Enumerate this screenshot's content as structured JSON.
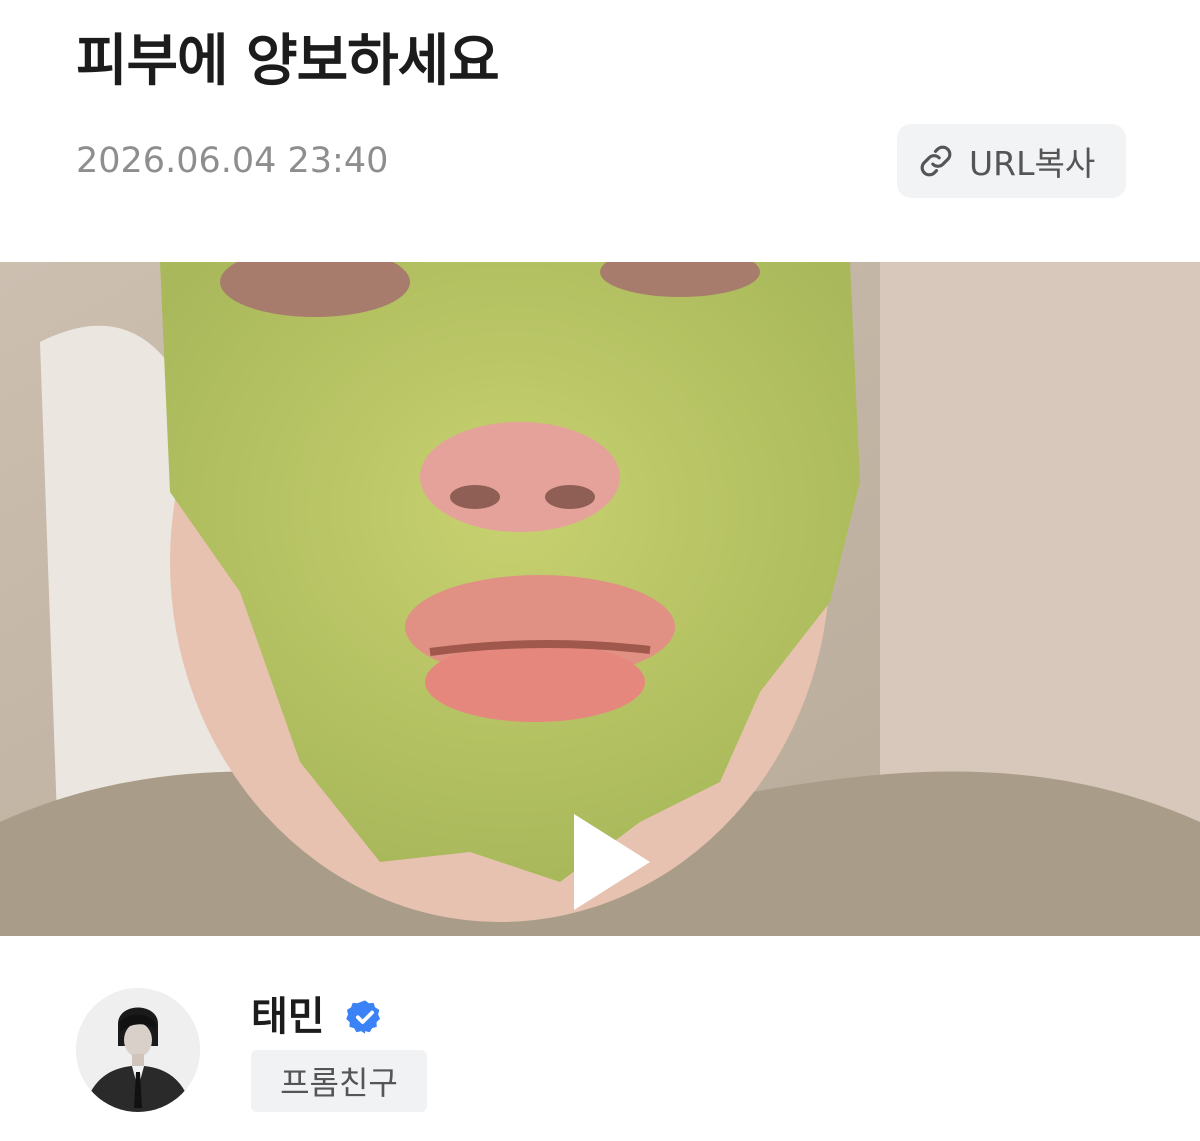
{
  "post": {
    "title": "피부에 양보하세요",
    "datetime": "2026.06.04 23:40",
    "url_copy_label": "URL복사"
  },
  "video": {
    "play_icon": "play-icon"
  },
  "author": {
    "name": "태민",
    "verified_icon": "verified-check-icon",
    "badge": "프롬친구"
  },
  "colors": {
    "verified_blue": "#3b82f6",
    "badge_bg": "#f1f2f4",
    "date_text": "#8e8e8e"
  }
}
